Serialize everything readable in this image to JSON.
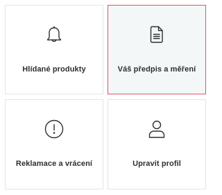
{
  "tiles": [
    {
      "label": "Hlídané produkty",
      "icon": "bell-icon",
      "active": false
    },
    {
      "label": "Váš předpis a měření",
      "icon": "document-icon",
      "active": true
    },
    {
      "label": "Reklamace a vrácení",
      "icon": "alert-circle-icon",
      "active": false
    },
    {
      "label": "Upravit profil",
      "icon": "user-icon",
      "active": false
    }
  ],
  "colors": {
    "active_border": "#d9546c",
    "active_background": "#f4f7f8",
    "border": "#e2e4e6",
    "text": "#2b2f33"
  }
}
